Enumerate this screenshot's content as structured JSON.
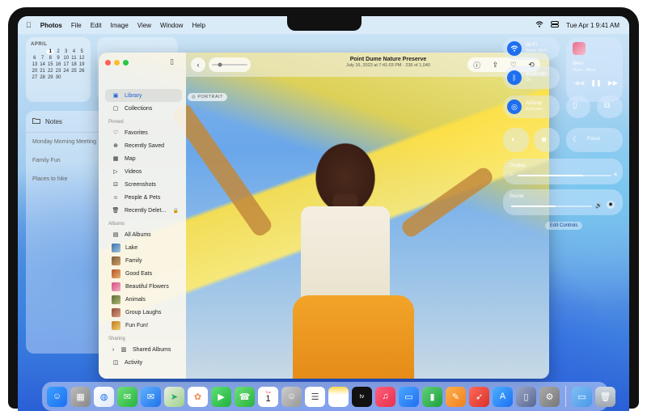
{
  "menubar": {
    "apple": "",
    "app": "Photos",
    "menus": [
      "File",
      "Edit",
      "Image",
      "View",
      "Window",
      "Help"
    ],
    "clock": "Tue Apr 1  9:41 AM"
  },
  "calendar": {
    "month": "APRIL",
    "days": [
      "",
      "",
      "1",
      "2",
      "3",
      "4",
      "5",
      "6",
      "7",
      "8",
      "9",
      "10",
      "11",
      "12",
      "13",
      "14",
      "15",
      "16",
      "17",
      "18",
      "19",
      "20",
      "21",
      "22",
      "23",
      "24",
      "25",
      "26",
      "27",
      "28",
      "29",
      "30"
    ]
  },
  "notes": {
    "title": "Notes",
    "items": [
      "Monday Morning Meeting",
      "Family Fun",
      "Places to hike"
    ]
  },
  "photos": {
    "title": "Point Dume Nature Preserve",
    "subtitle": "July 16, 2023 at 7:41:03 PM  ·  236 of 1,040",
    "portrait": "PORTRAIT",
    "library": "Library",
    "collections": "Collections",
    "pinned_header": "Pinned",
    "pinned": [
      "Favorites",
      "Recently Saved",
      "Map",
      "Videos",
      "Screenshots",
      "People & Pets",
      "Recently Delet..."
    ],
    "albums_header": "Albums",
    "albums": [
      "All Albums",
      "Lake",
      "Family",
      "Good Eats",
      "Beautiful Flowers",
      "Animals",
      "Group Laughs",
      "Fun Fun!"
    ],
    "sharing_header": "Sharing",
    "sharing": [
      "Shared Albums",
      "Activity"
    ]
  },
  "control_center": {
    "wifi": {
      "label": "Wi-Fi",
      "sub": "Home Wi-Fi"
    },
    "bluetooth": {
      "label": "Bluetooth",
      "sub": "On"
    },
    "airdrop": {
      "label": "AirDrop",
      "sub": "Everyone"
    },
    "now_playing": {
      "title": "Blest",
      "artist": "Yuno – Blest"
    },
    "focus": "Focus",
    "display": {
      "label": "Display",
      "level": 0.7
    },
    "sound": {
      "label": "Sound",
      "level": 0.55
    },
    "edit": "Edit Controls"
  },
  "colors": {
    "accent": "#1e6ff0",
    "sidebar_active": "#1a5fd4"
  }
}
